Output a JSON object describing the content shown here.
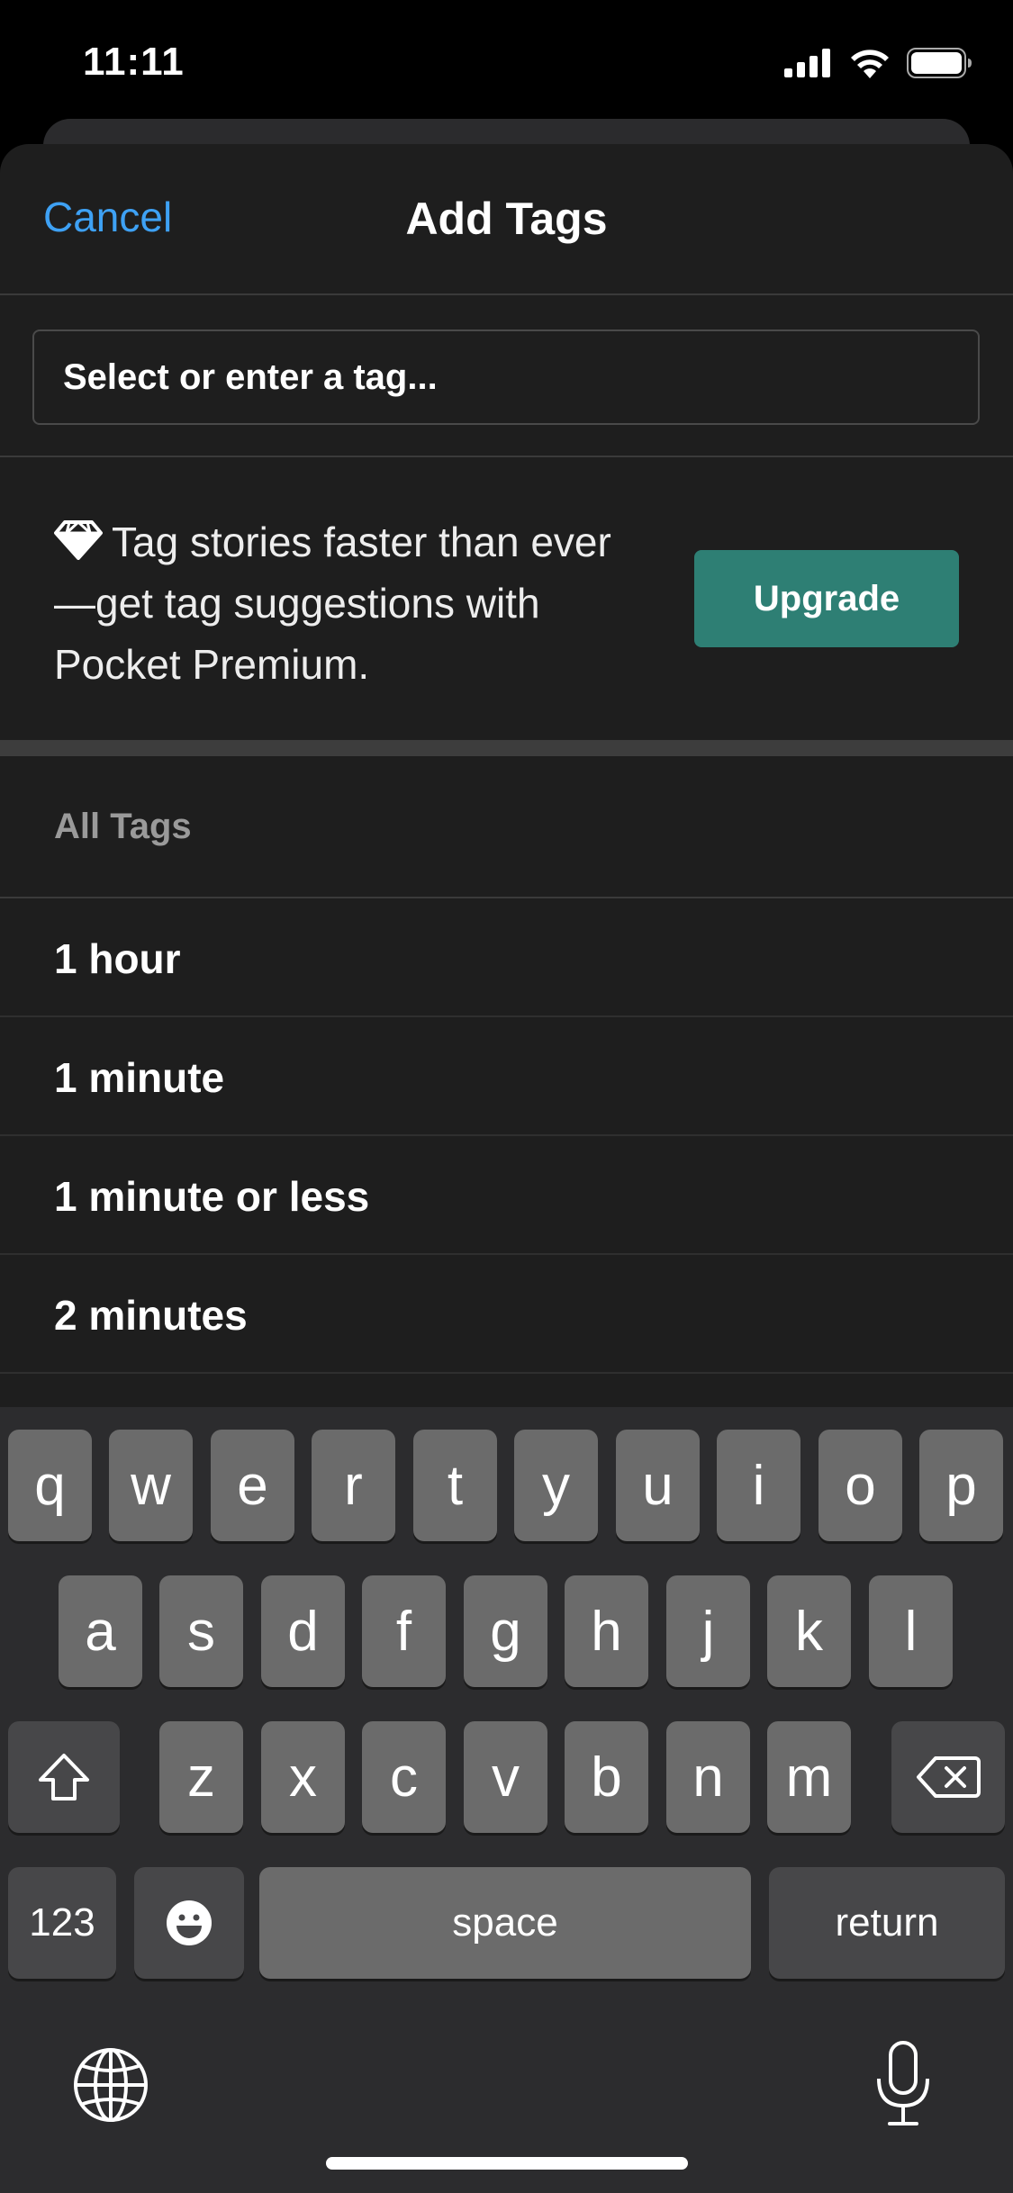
{
  "status_bar": {
    "time": "11:11"
  },
  "nav": {
    "cancel_label": "Cancel",
    "title": "Add Tags"
  },
  "tag_input": {
    "placeholder": "Select or enter a tag..."
  },
  "promo": {
    "text": "Tag stories faster than ever—get tag suggestions with Pocket Premium.",
    "upgrade_label": "Upgrade",
    "accent_color": "#2e7f74"
  },
  "all_tags": {
    "header": "All Tags",
    "items": [
      "1 hour",
      "1 minute",
      "1 minute or less",
      "2 minutes"
    ]
  },
  "keyboard": {
    "row1": [
      "q",
      "w",
      "e",
      "r",
      "t",
      "y",
      "u",
      "i",
      "o",
      "p"
    ],
    "row2": [
      "a",
      "s",
      "d",
      "f",
      "g",
      "h",
      "j",
      "k",
      "l"
    ],
    "row3": [
      "z",
      "x",
      "c",
      "v",
      "b",
      "n",
      "m"
    ],
    "numbers_label": "123",
    "space_label": "space",
    "return_label": "return"
  },
  "colors": {
    "link": "#3ea1f4",
    "background": "#1e1e1e"
  }
}
